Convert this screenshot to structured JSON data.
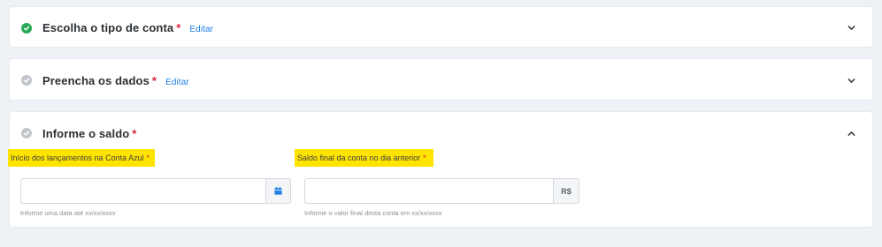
{
  "steps": [
    {
      "title": "Escolha o tipo de conta",
      "required_mark": "*",
      "edit_label": "Editar",
      "status": "done",
      "status_icon": "check-circle-icon",
      "chevron_icon": "chevron-down-icon"
    },
    {
      "title": "Preencha os dados",
      "required_mark": "*",
      "edit_label": "Editar",
      "status": "pending",
      "status_icon": "check-circle-icon",
      "chevron_icon": "chevron-down-icon"
    },
    {
      "title": "Informe o saldo",
      "required_mark": "*",
      "status": "pending",
      "status_icon": "check-circle-icon",
      "chevron_icon": "chevron-up-icon"
    }
  ],
  "balance_form": {
    "start_date": {
      "label": "Início dos lançamentos na Conta Azul",
      "required_mark": "*",
      "value": "",
      "placeholder": "",
      "addon_icon": "calendar-icon",
      "hint": "Informe uma data até xx/xx/xxxx"
    },
    "final_balance": {
      "label": "Saldo final da conta no dia anterior",
      "required_mark": "*",
      "value": "",
      "placeholder": "",
      "addon_label": "R$",
      "hint": "Informe o valor final desta conta em xx/xx/xxxx"
    }
  },
  "colors": {
    "page_background": "#eef1f6",
    "success": "#29a957",
    "pending": "#c2c6cc",
    "required": "#d5263d",
    "link": "#1f7ee6",
    "highlight": "#ffe400",
    "calendar_icon": "#1f7ee6"
  }
}
